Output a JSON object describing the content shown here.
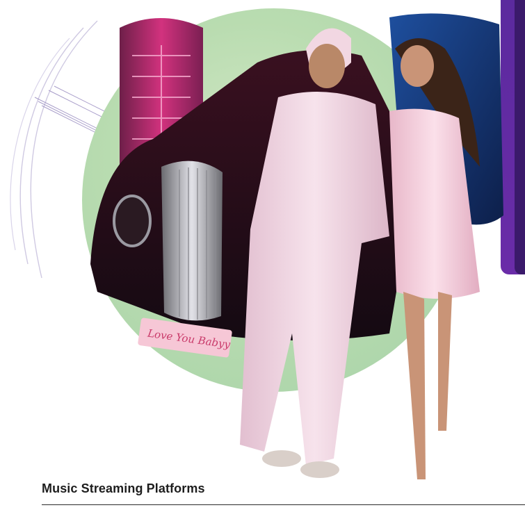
{
  "section": {
    "title": "Music Streaming Platforms"
  },
  "hero": {
    "image_alt": "Promotional photo of a man in a turban and a pink suit posing with a woman in a sparkly pink dress beside a vintage car and a red telephone booth",
    "plate_text": "Love You Babyy"
  },
  "colors": {
    "circle": "#b9dcb0",
    "panel": "#5b2a9e",
    "title": "#1d1d1d",
    "arcs": "#c9c3dd"
  }
}
